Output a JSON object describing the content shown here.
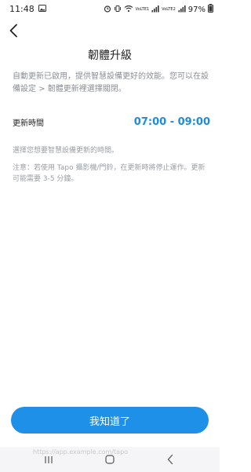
{
  "status_bar": {
    "time": "11:48",
    "volte1": "VoLTE1",
    "volte2": "VoLTE2",
    "battery": "97%"
  },
  "header": {
    "title": "韌體升級"
  },
  "content": {
    "intro": "自動更新已啟用，提供智慧設備更好的效能。您可以在設備設定 > 韌體更新裡選擇關閉。",
    "time_label": "更新時間",
    "time_value": "07:00 - 09:00",
    "hint": "選擇您想要智慧設備更新的時間。",
    "note": "注意：若使用 Tapo 攝影機/門鈴，在更新時將停止運作。更新可能需要 3-5 分鐘。"
  },
  "actions": {
    "confirm_label": "我知道了"
  },
  "nav_bar": {
    "watermark": "https://app.example.com/tapo"
  },
  "colors": {
    "accent": "#1f90e8",
    "time_value": "#1d8ce0"
  }
}
